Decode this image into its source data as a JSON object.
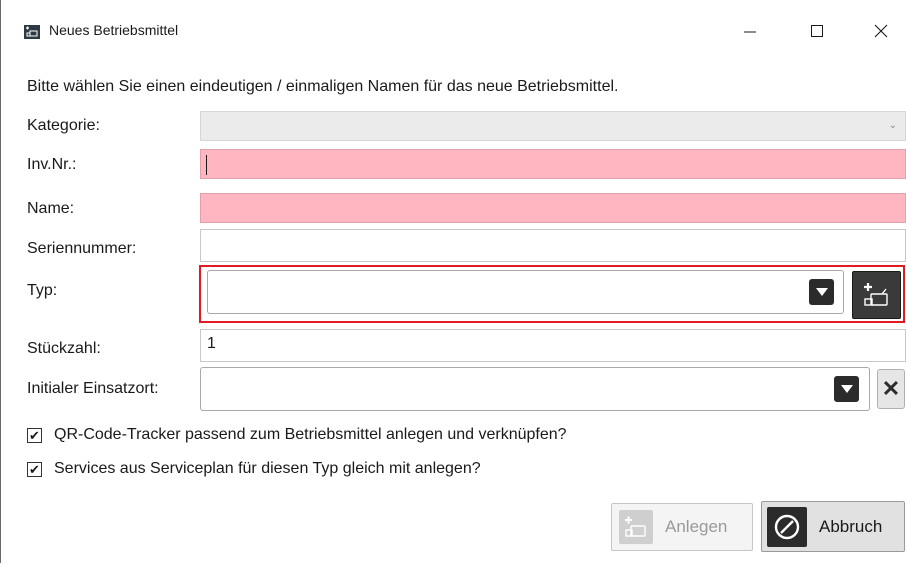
{
  "window": {
    "title": "Neues Betriebsmittel",
    "icons": [
      "app-icon",
      "minimize-icon",
      "maximize-icon",
      "close-icon"
    ]
  },
  "intro": "Bitte wählen Sie einen eindeutigen / einmaligen Namen für das neue Betriebsmittel.",
  "form": {
    "kategorie": {
      "label": "Kategorie:",
      "value": ""
    },
    "invnr": {
      "label": "Inv.Nr.:",
      "value": ""
    },
    "name": {
      "label": "Name:",
      "value": ""
    },
    "seriennummer": {
      "label": "Seriennummer:",
      "value": ""
    },
    "typ": {
      "label": "Typ:",
      "value": ""
    },
    "stueckzahl": {
      "label": "Stückzahl:",
      "value": "1"
    },
    "einsatzort": {
      "label": "Initialer Einsatzort:",
      "value": ""
    }
  },
  "checkboxes": [
    {
      "label": "QR-Code-Tracker passend zum Betriebsmittel anlegen und verknüpfen?",
      "checked": true
    },
    {
      "label": "Services aus Serviceplan für diesen Typ gleich mit anlegen?",
      "checked": true
    }
  ],
  "buttons": {
    "anlegen": "Anlegen",
    "abbruch": "Abbruch"
  },
  "colors": {
    "required_field": "#ffb6c1",
    "highlight_frame": "#e01b24",
    "dark_button": "#2b2b2b"
  }
}
